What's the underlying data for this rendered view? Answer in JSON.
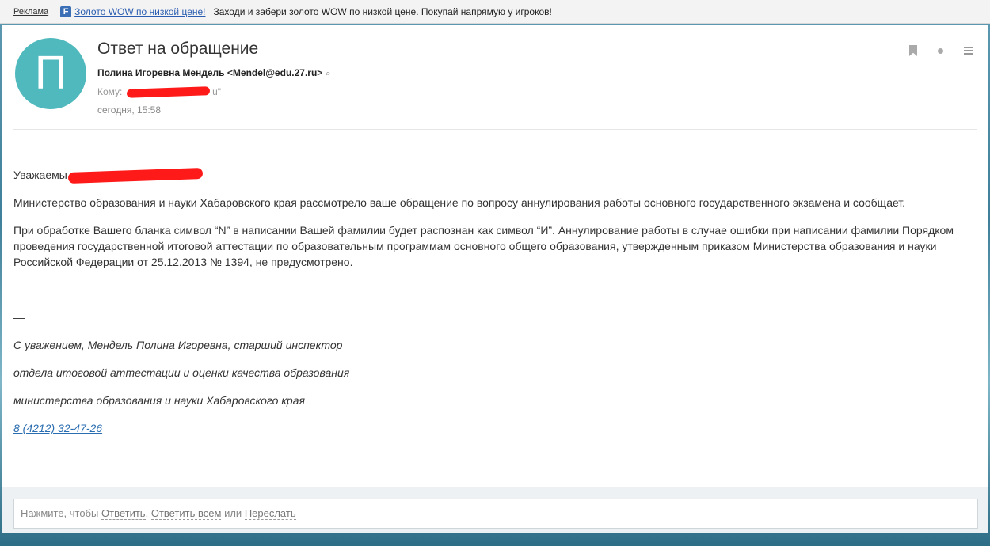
{
  "ad": {
    "tag": "Реклама",
    "icon": "F",
    "link": "Золото WOW по низкой цене!",
    "text": "Заходи и забери золото WOW по низкой цене. Покупай напрямую у игроков!"
  },
  "message": {
    "avatar_letter": "П",
    "subject": "Ответ на обращение",
    "from": "Полина Игоревна Мендель <Mendel@edu.27.ru>",
    "to_label": "Кому:",
    "to_suffix": "u\"",
    "date": "сегодня, 15:58"
  },
  "body": {
    "greeting": "Уважаемы",
    "para1": "Министерство образования и науки Хабаровского края рассмотрело ваше обращение по вопросу аннулирования работы основного государственного экзамена и сообщает.",
    "para2": "При обработке Вашего бланка символ “N” в написании Вашей фамилии будет распознан как символ “И”. Аннулирование работы в случае ошибки при написании фамилии Порядком проведения государственной итоговой аттестации по образовательным программам основного общего образования, утвержденным приказом Министерства образования и науки Российской Федерации от 25.12.2013 № 1394, не предусмотрено.",
    "sig_dash": "—",
    "sig1": "С уважением, Мендель Полина Игоревна, старший инспектор",
    "sig2": "отдела итоговой аттестации и оценки качества образования",
    "sig3": "министерства образования и науки Хабаровского края",
    "phone": "8 (4212) 32-47-26"
  },
  "reply": {
    "prefix": "Нажмите, чтобы",
    "reply": "Ответить",
    "sep1": ",",
    "reply_all": "Ответить всем",
    "or": "или",
    "forward": "Переслать"
  },
  "icons": [
    "bookmark-icon",
    "dot-icon",
    "menu-icon",
    "search-icon"
  ]
}
